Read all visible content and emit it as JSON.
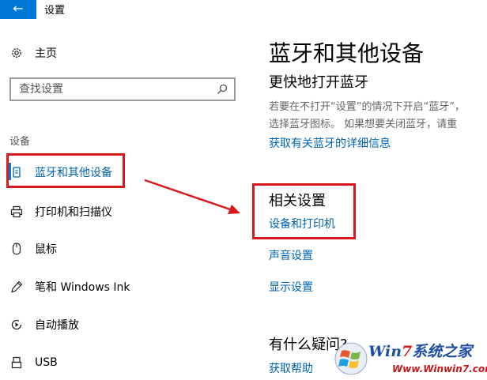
{
  "window": {
    "title": "设置",
    "back_glyph": "←"
  },
  "sidebar": {
    "home_label": "主页",
    "search_placeholder": "查找设置",
    "section_label": "设备",
    "items": [
      {
        "label": "蓝牙和其他设备",
        "icon": "bluetooth-device-icon",
        "selected": true
      },
      {
        "label": "打印机和扫描仪",
        "icon": "printer-icon"
      },
      {
        "label": "鼠标",
        "icon": "mouse-icon"
      },
      {
        "label": "笔和 Windows Ink",
        "icon": "pen-icon"
      },
      {
        "label": "自动播放",
        "icon": "autoplay-icon"
      },
      {
        "label": "USB",
        "icon": "usb-icon"
      }
    ]
  },
  "main": {
    "title": "蓝牙和其他设备",
    "quick_title": "更快地打开蓝牙",
    "quick_desc_line1": "若要在不打开“设置”的情况下开启“蓝牙”，",
    "quick_desc_line2": "选择蓝牙图标。 如果想要关闭蓝牙，请重",
    "bt_info_link": "获取有关蓝牙的详细信息",
    "related_title": "相关设置",
    "related_links": [
      "设备和打印机",
      "声音设置",
      "显示设置"
    ],
    "faq_title": "有什么疑问?",
    "help_link": "获取帮助"
  },
  "watermark": {
    "brand_prefix": "Win",
    "brand_seven": "7",
    "brand_suffix": "系统之家",
    "url": "Www.Winwin7.com"
  },
  "colors": {
    "accent": "#0078d7",
    "link": "#0063b1",
    "annotation_red": "#d7191c"
  }
}
